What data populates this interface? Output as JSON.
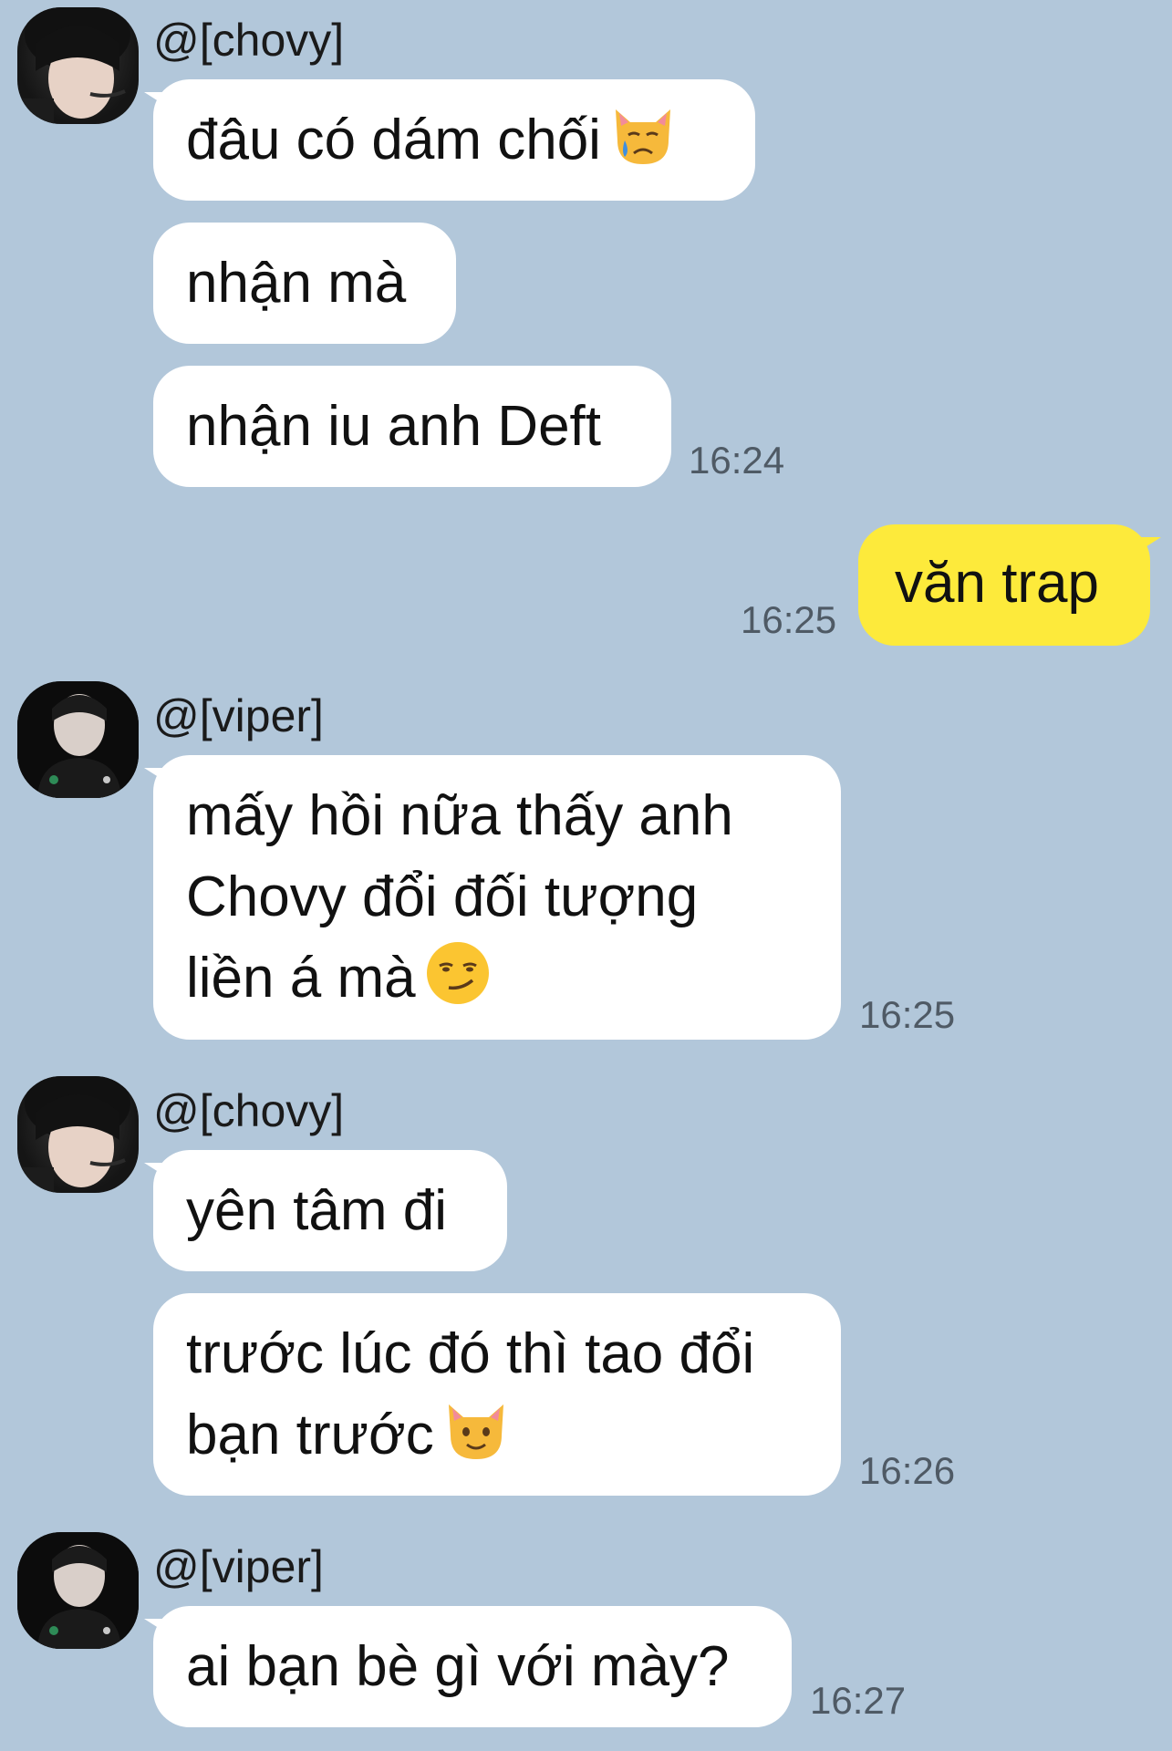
{
  "messages": [
    {
      "sender": "@[chovy]",
      "bubbles": [
        "đâu có dám chối",
        "nhận mà",
        "nhận iu anh Deft"
      ],
      "time": "16:24",
      "emoji": "crying-cat-emoji"
    },
    {
      "sender": "me",
      "bubbles": [
        "văn trap"
      ],
      "time": "16:25"
    },
    {
      "sender": "@[viper]",
      "lines": [
        "mấy hồi nữa thấy anh",
        "Chovy đổi đối tượng",
        "liền á mà"
      ],
      "time": "16:25",
      "emoji": "smirking-face-emoji"
    },
    {
      "sender": "@[chovy]",
      "bubbles": [
        "yên tâm đi"
      ],
      "lines": [
        "trước lúc đó thì tao đổi",
        "bạn trước"
      ],
      "time": "16:26",
      "emoji": "smiling-cat-emoji"
    },
    {
      "sender": "@[viper]",
      "bubbles": [
        "ai bạn bè gì với mày?"
      ],
      "time": "16:27"
    }
  ],
  "colors": {
    "background": "#b2c7da",
    "incoming_bubble": "#ffffff",
    "outgoing_bubble": "#fdea3b"
  }
}
